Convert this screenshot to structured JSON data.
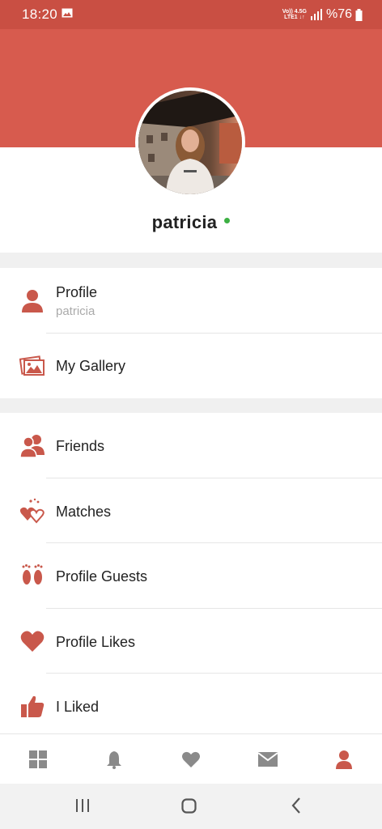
{
  "status_bar": {
    "time": "18:20",
    "network_top": "Vo)) 4.5G",
    "network_bottom": "LTE1 ↓↑",
    "battery_percent": "%76"
  },
  "profile": {
    "name": "patricia",
    "online": true
  },
  "menu": {
    "profile": {
      "label": "Profile",
      "subtitle": "patricia",
      "icon": "person-icon"
    },
    "gallery": {
      "label": "My Gallery",
      "icon": "photos-icon"
    },
    "friends": {
      "label": "Friends",
      "icon": "friends-icon"
    },
    "matches": {
      "label": "Matches",
      "icon": "hearts-icon"
    },
    "guests": {
      "label": "Profile Guests",
      "icon": "footprints-icon"
    },
    "likes": {
      "label": "Profile Likes",
      "icon": "heart-icon"
    },
    "liked": {
      "label": "I Liked",
      "icon": "thumbs-up-icon"
    }
  },
  "bottom_nav": [
    "grid-icon",
    "bell-icon",
    "heart-icon",
    "mail-icon",
    "person-icon"
  ],
  "colors": {
    "accent": "#c9584b",
    "header": "#d75b4e",
    "status_bar": "#c94f43",
    "online": "#3cb043",
    "inactive_nav": "#8a8a8a"
  }
}
